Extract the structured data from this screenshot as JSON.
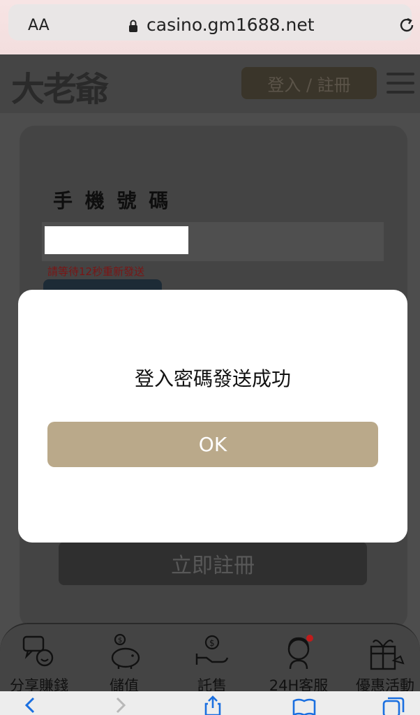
{
  "browser": {
    "aa_label": "AA",
    "url": "casino.gm1688.net"
  },
  "header": {
    "logo_text": "大老爺",
    "login_button": "登入 / 註冊"
  },
  "form": {
    "phone_label": "手 機 號 碼",
    "wait_text": "請等待12秒重新發送",
    "register_button": "立即註冊"
  },
  "modal": {
    "message": "登入密碼發送成功",
    "ok_label": "OK"
  },
  "bottom_nav": {
    "items": [
      {
        "label": "分享賺錢",
        "icon": "share-earn-icon"
      },
      {
        "label": "儲值",
        "icon": "piggy-bank-icon"
      },
      {
        "label": "託售",
        "icon": "hand-coin-icon"
      },
      {
        "label": "24H客服",
        "icon": "customer-service-icon"
      },
      {
        "label": "優惠活動",
        "icon": "gift-icon"
      }
    ]
  },
  "colors": {
    "ok_button": "#baa98a",
    "overlay": "#4d4d4d",
    "url_bar": "#f3dede"
  }
}
